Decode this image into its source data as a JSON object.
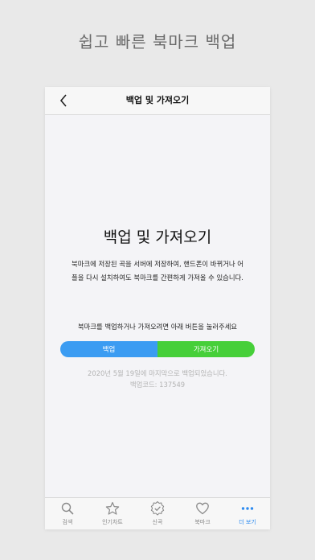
{
  "headline": "쉽고 빠른 북마크 백업",
  "navbar": {
    "title": "백업 및 가져오기"
  },
  "content": {
    "title": "백업 및 가져오기",
    "description_line1": "북마크에 저장된 곡을 서버에 저장하여, 핸드폰이 바뀌거나 어",
    "description_line2": "플을 다시 설치하여도 북마크를 간편하게 가져올 수 있습니다.",
    "instruction": "북마크를 백업하거나 가져오려면 아래 버튼을 눌러주세요",
    "backup_label": "백업",
    "import_label": "가져오기",
    "last_backup": "2020년 5월 19일에 마지막으로 백업되었습니다.",
    "backup_code": "백업코드: 137549"
  },
  "colors": {
    "backup": "#3b9cf2",
    "import": "#46cf39",
    "active_tab": "#2f8cf0"
  },
  "tabs": [
    {
      "label": "검색",
      "icon": "search-icon"
    },
    {
      "label": "인기차트",
      "icon": "star-icon"
    },
    {
      "label": "신곡",
      "icon": "new-badge-icon"
    },
    {
      "label": "북마크",
      "icon": "heart-icon"
    },
    {
      "label": "더 보기",
      "icon": "more-dots-icon",
      "active": true
    }
  ]
}
